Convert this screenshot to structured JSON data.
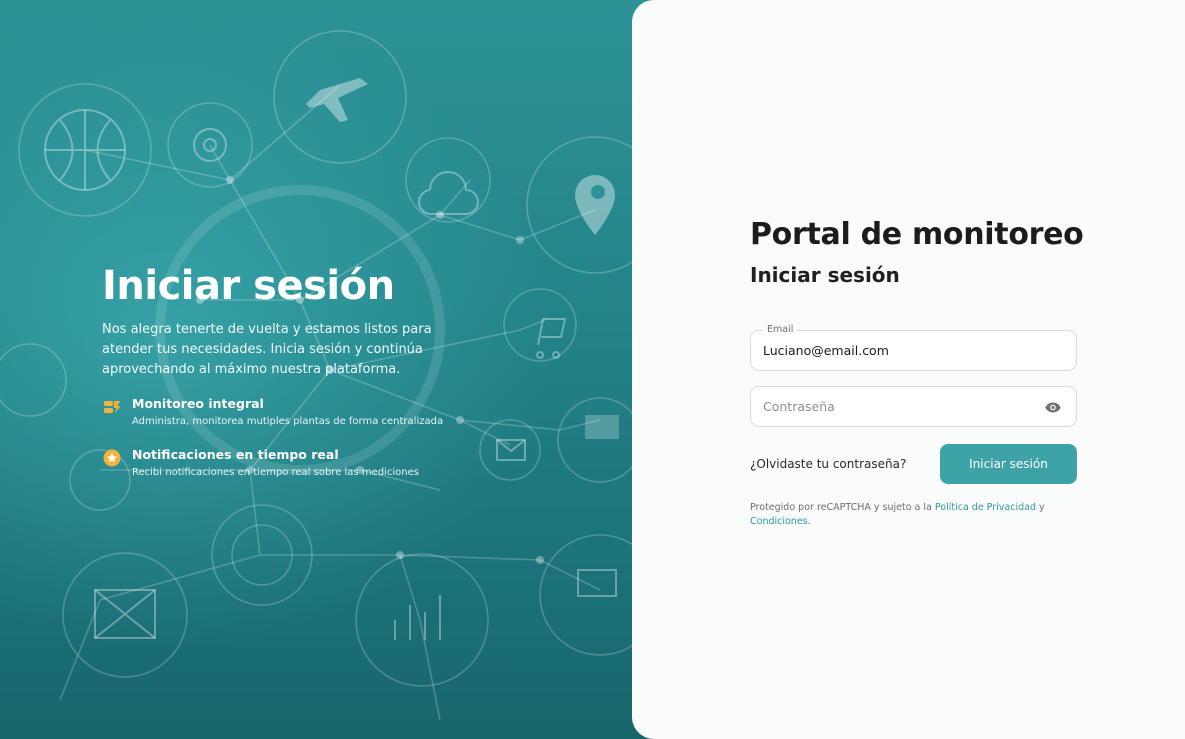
{
  "hero": {
    "title": "Iniciar sesión",
    "description": "Nos alegra tenerte de vuelta y estamos listos para atender tus necesidades. Inicia sesión y continúa aprovechando al máximo nuestra plataforma.",
    "features": [
      {
        "icon": "monitoring-tag-icon",
        "title": "Monitoreo integral",
        "text": "Administra, monitorea mutiples plantas de forma centralizada"
      },
      {
        "icon": "star-badge-icon",
        "title": "Notificaciones en tiempo real",
        "text": "Recibi notificaciones en tiempo real sobre las mediciones"
      }
    ]
  },
  "form": {
    "portal_title": "Portal de monitoreo",
    "title": "Iniciar sesión",
    "email": {
      "label": "Email",
      "value": "Luciano@email.com"
    },
    "password": {
      "placeholder": "Contraseña"
    },
    "forgot_label": "¿Olvidaste tu contraseña?",
    "submit_label": "Iniciar sesión",
    "legal": {
      "prefix": "Protegido por reCAPTCHA y sujeto a la ",
      "privacy_link": "Política de Privacidad",
      "middle": " y ",
      "terms_link": "Condiciones",
      "suffix": "."
    }
  },
  "colors": {
    "accent": "#3ea3a6",
    "hero_teal": "#23858b",
    "feature_icon": "#f3b23b",
    "panel_bg": "#fafbfb"
  }
}
